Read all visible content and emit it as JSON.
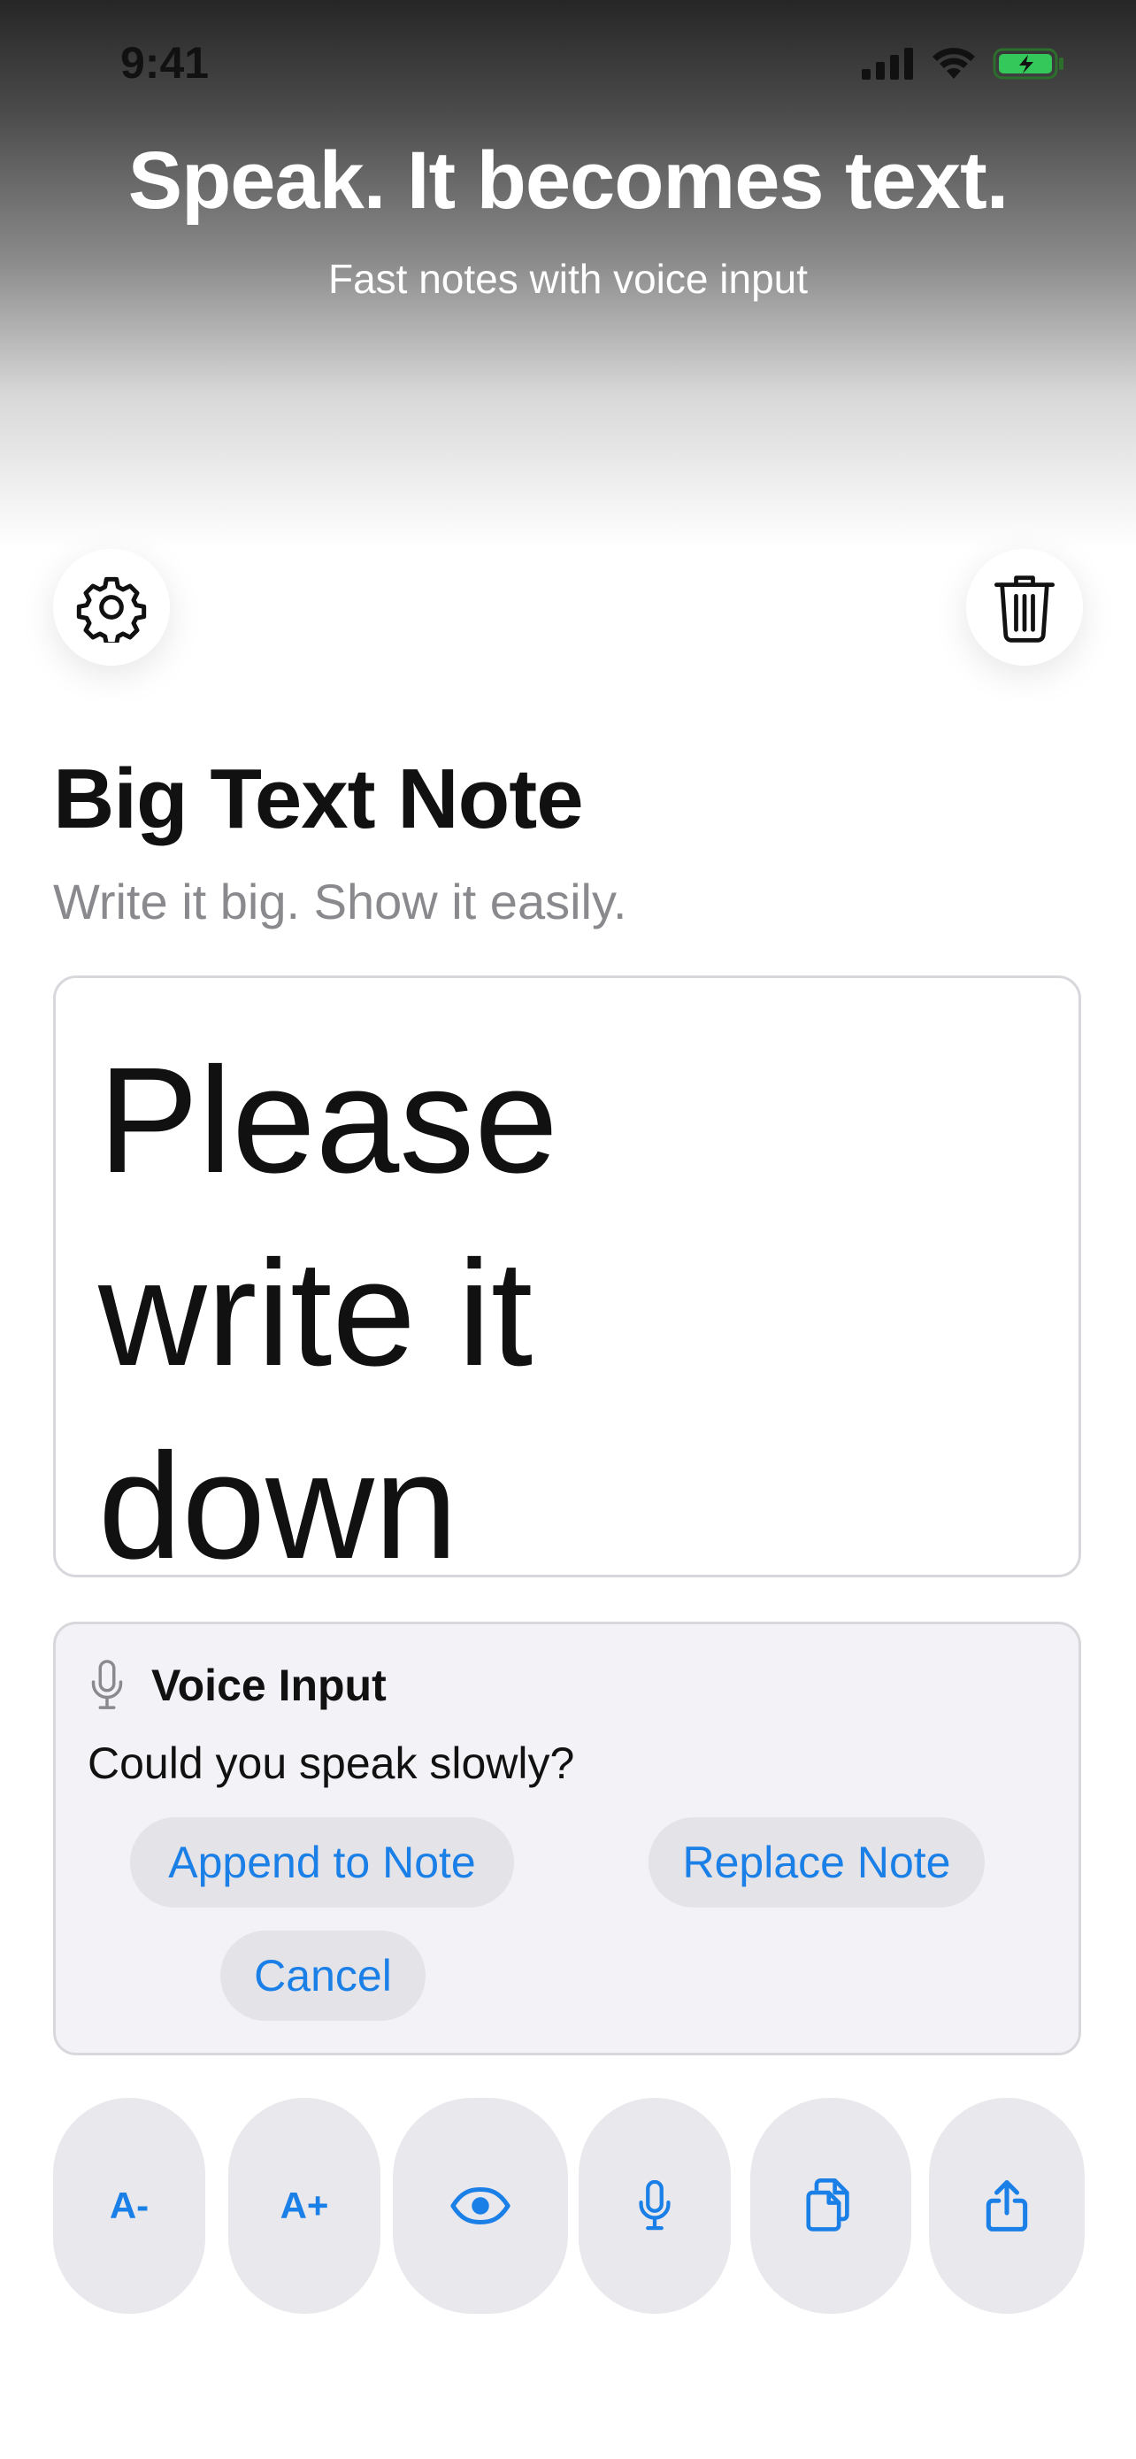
{
  "status_bar": {
    "time": "9:41"
  },
  "hero": {
    "title": "Speak. It becomes text.",
    "subtitle": "Fast notes with voice input"
  },
  "header": {
    "settings_icon": "gear-icon",
    "trash_icon": "trash-icon"
  },
  "app": {
    "title": "Big Text Note",
    "subtitle": "Write it big. Show it easily."
  },
  "note": {
    "text": "Please\nwrite it\ndown"
  },
  "voice_panel": {
    "title": "Voice Input",
    "transcript": "Could you speak slowly?",
    "append_label": "Append to Note",
    "replace_label": "Replace Note",
    "cancel_label": "Cancel"
  },
  "toolbar": {
    "decrease_label": "A-",
    "increase_label": "A+",
    "icons": [
      "eye-icon",
      "microphone-icon",
      "copy-icon",
      "share-icon"
    ]
  },
  "colors": {
    "accent": "#1a7fe6",
    "panel_bg": "#f2f2f7",
    "button_bg": "#e8e8ed"
  }
}
